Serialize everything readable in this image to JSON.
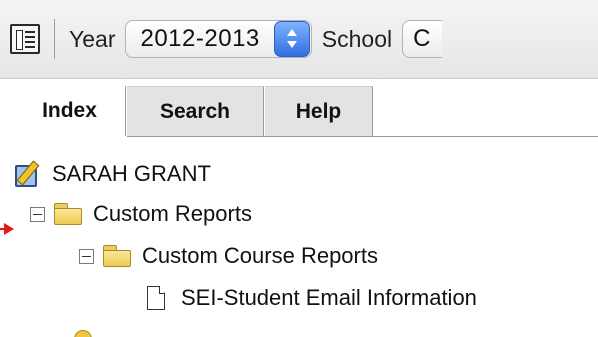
{
  "toolbar": {
    "year_label": "Year",
    "year_value": "2012-2013",
    "school_label": "School",
    "school_value": "C"
  },
  "tabs": [
    {
      "label": "Index",
      "active": true
    },
    {
      "label": "Search",
      "active": false
    },
    {
      "label": "Help",
      "active": false
    }
  ],
  "tree": {
    "root": {
      "label": "SARAH GRANT",
      "icon": "edit-profile-icon"
    },
    "folder_1": {
      "label": "Custom Reports",
      "icon": "folder-icon",
      "expanded": true
    },
    "folder_2": {
      "label": "Custom Course Reports",
      "icon": "folder-icon",
      "expanded": true
    },
    "report_1": {
      "label": "SEI-Student Email Information",
      "icon": "document-icon"
    }
  },
  "colors": {
    "accent_blue": "#2f6fe0",
    "arrow_red": "#e11a1a",
    "folder_yellow": "#efc952"
  }
}
